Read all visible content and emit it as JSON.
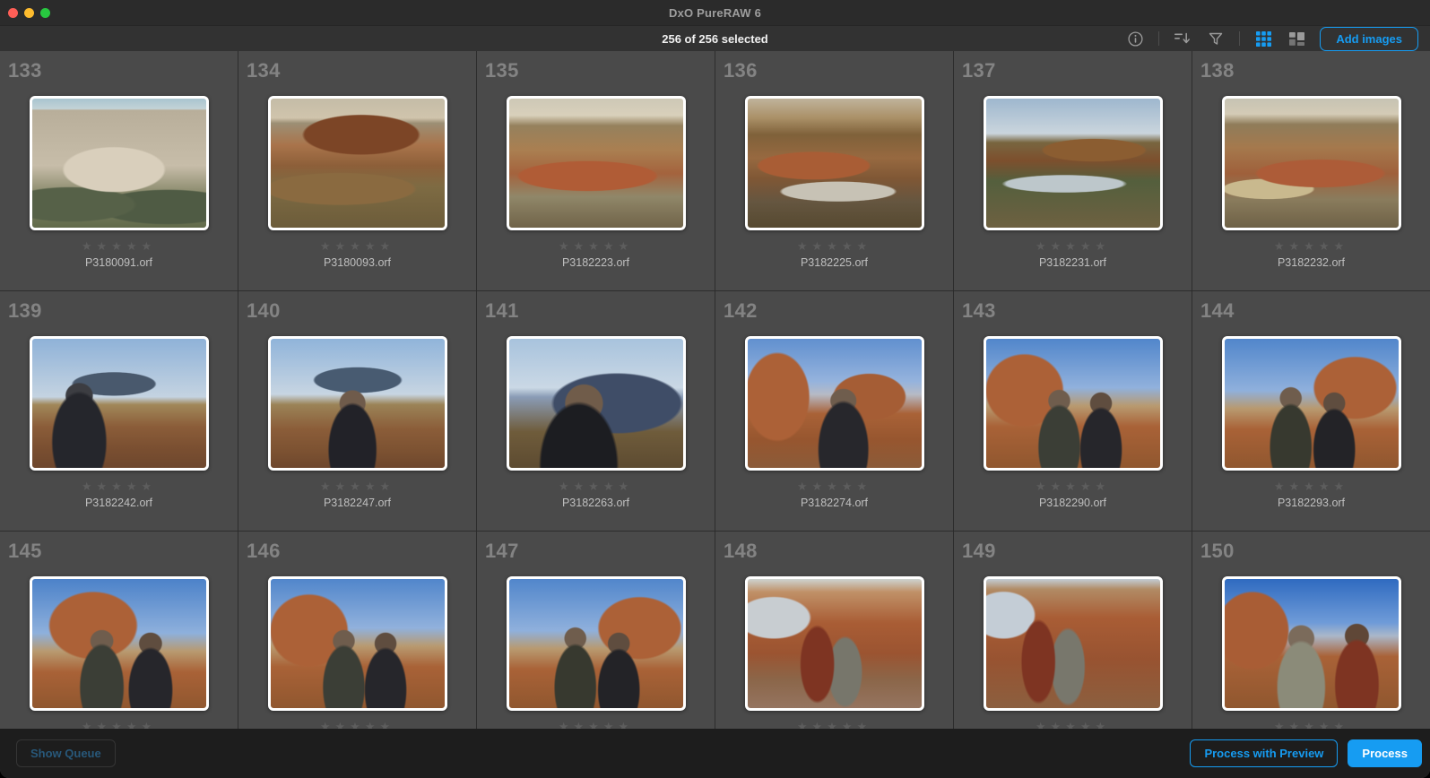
{
  "window": {
    "title": "DxO PureRAW 6"
  },
  "toolbar": {
    "selection_status": "256 of 256 selected",
    "add_images_label": "Add images",
    "icons": [
      "info-icon",
      "sort-icon",
      "filter-icon",
      "grid-view-icon",
      "mosaic-view-icon"
    ],
    "active_view": "grid"
  },
  "colors": {
    "accent_blue": "#169cf2",
    "titlebar": "#2b2b2b",
    "toolbar": "#323232",
    "cell_background": "#4a4a4a",
    "grid_divider": "#2c2c2c",
    "footer_background": "#1d1d1d",
    "traffic_red": "#ff5f57",
    "traffic_yellow": "#febc2e",
    "traffic_green": "#28c840"
  },
  "grid": {
    "star_glyphs": "★★★★★",
    "photos": [
      {
        "index": "133",
        "filename": "P3180091.orf",
        "rating": 0,
        "scene": "pale-cliff-shrubs"
      },
      {
        "index": "134",
        "filename": "P3180093.orf",
        "rating": 0,
        "scene": "red-mesa-valley"
      },
      {
        "index": "135",
        "filename": "P3182223.orf",
        "rating": 0,
        "scene": "red-badlands-valley"
      },
      {
        "index": "136",
        "filename": "P3182225.orf",
        "rating": 0,
        "scene": "dawn-river-valley"
      },
      {
        "index": "137",
        "filename": "P3182231.orf",
        "rating": 0,
        "scene": "sky-river-valley"
      },
      {
        "index": "138",
        "filename": "P3182232.orf",
        "rating": 0,
        "scene": "red-badlands-valley-2"
      },
      {
        "index": "139",
        "filename": "P3182242.orf",
        "rating": 0,
        "scene": "photographer-mesa"
      },
      {
        "index": "140",
        "filename": "P3182247.orf",
        "rating": 0,
        "scene": "man-camera-mesa"
      },
      {
        "index": "141",
        "filename": "P3182263.orf",
        "rating": 0,
        "scene": "portrait-man-mesa"
      },
      {
        "index": "142",
        "filename": "P3182274.orf",
        "rating": 0,
        "scene": "man-hoodoos"
      },
      {
        "index": "143",
        "filename": "P3182290.orf",
        "rating": 0,
        "scene": "two-men-hoodoos"
      },
      {
        "index": "144",
        "filename": "P3182293.orf",
        "rating": 0,
        "scene": "two-men-hoodoos-2"
      },
      {
        "index": "145",
        "filename": "",
        "rating": 0,
        "scene": "two-men-hoodoos-3"
      },
      {
        "index": "146",
        "filename": "",
        "rating": 0,
        "scene": "two-men-hoodoos"
      },
      {
        "index": "147",
        "filename": "",
        "rating": 0,
        "scene": "two-men-hoodoos-2"
      },
      {
        "index": "148",
        "filename": "",
        "rating": 0,
        "scene": "two-men-redwall"
      },
      {
        "index": "149",
        "filename": "",
        "rating": 0,
        "scene": "two-men-redwall-2"
      },
      {
        "index": "150",
        "filename": "",
        "rating": 0,
        "scene": "two-men-sky"
      }
    ]
  },
  "footer": {
    "show_queue_label": "Show Queue",
    "process_with_preview_label": "Process with Preview",
    "process_label": "Process"
  }
}
